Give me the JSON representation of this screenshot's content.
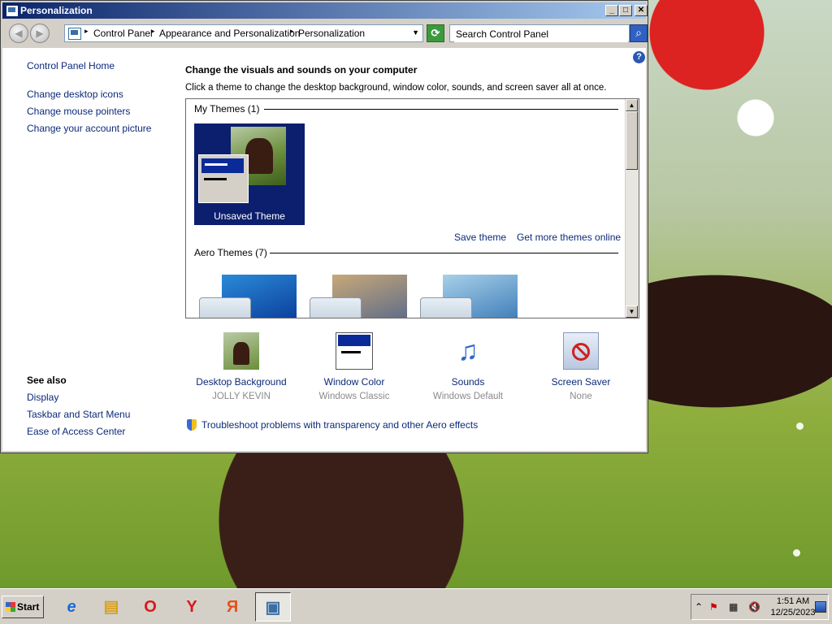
{
  "window": {
    "title": "Personalization",
    "buttons": {
      "minimize": "_",
      "maximize": "□",
      "close": "✕"
    }
  },
  "address_bar": {
    "crumbs": [
      "Control Panel",
      "Appearance and Personalization",
      "Personalization"
    ],
    "search_placeholder": "Search Control Panel"
  },
  "sidebar": {
    "home": "Control Panel Home",
    "tasks": [
      "Change desktop icons",
      "Change mouse pointers",
      "Change your account picture"
    ],
    "see_also_title": "See also",
    "see_also": [
      "Display",
      "Taskbar and Start Menu",
      "Ease of Access Center"
    ]
  },
  "main": {
    "heading": "Change the visuals and sounds on your computer",
    "subtext": "Click a theme to change the desktop background, window color, sounds, and screen saver all at once.",
    "my_themes_label": "My Themes (1)",
    "unsaved_theme_label": "Unsaved Theme",
    "save_theme": "Save theme",
    "get_more": "Get more themes online",
    "aero_themes_label": "Aero Themes (7)",
    "help": "?"
  },
  "settings": [
    {
      "label": "Desktop Background",
      "value": "JOLLY KEVIN",
      "icon": "desktop-background-icon"
    },
    {
      "label": "Window Color",
      "value": "Windows Classic",
      "icon": "window-color-icon"
    },
    {
      "label": "Sounds",
      "value": "Windows Default",
      "icon": "sounds-icon"
    },
    {
      "label": "Screen Saver",
      "value": "None",
      "icon": "screen-saver-icon"
    }
  ],
  "troubleshoot": "Troubleshoot problems with transparency and other Aero effects",
  "taskbar": {
    "start": "Start",
    "apps": [
      {
        "name": "internet-explorer",
        "glyph": "e",
        "color": "#1a6ad8"
      },
      {
        "name": "windows-explorer",
        "glyph": "▤",
        "color": "#d8a020"
      },
      {
        "name": "opera",
        "glyph": "O",
        "color": "#d81a1a"
      },
      {
        "name": "yandex-browser",
        "glyph": "Y",
        "color": "#d81a1a"
      },
      {
        "name": "yandex",
        "glyph": "Я",
        "color": "#e8501a"
      },
      {
        "name": "control-panel",
        "glyph": "▣",
        "color": "#3a6ea5"
      }
    ],
    "time": "1:51 AM",
    "date": "12/25/2023"
  },
  "colors": {
    "link": "#0b2a7a",
    "title_start": "#0a246a",
    "title_end": "#a6caf0"
  }
}
